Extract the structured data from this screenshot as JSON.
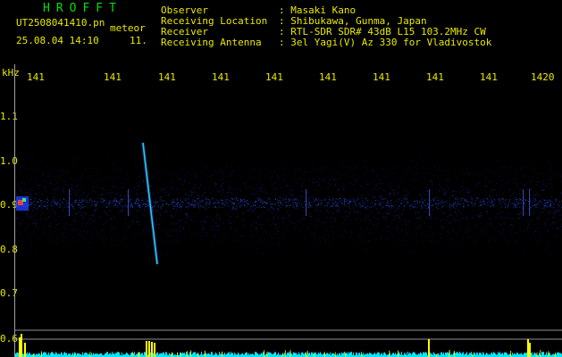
{
  "header": {
    "app_title": "HROFFT",
    "file_name": "UT2508041410.pn",
    "file_tag": "meteor",
    "datetime": "25.08.04 14:10",
    "sequence": "11."
  },
  "metadata": {
    "observer_label": "Observer",
    "observer_value": ": Masaki Kano",
    "location_label": "Receiving Location",
    "location_value": ": Shibukawa, Gunma, Japan",
    "receiver_label": "Receiver",
    "receiver_value": ": RTL-SDR SDR# 43dB L15 103.2MHz CW",
    "antenna_label": "Receiving Antenna",
    "antenna_value": ": 3el Yagi(V) Az 330 for Vladivostok"
  },
  "axis": {
    "unit_label": "kHz",
    "y_ticks": [
      "1.1",
      "1.0",
      "0.9",
      "0.8",
      "0.7",
      "0.6"
    ],
    "x_ticks": [
      "141",
      "141",
      "141",
      "141",
      "141",
      "141",
      "141",
      "141",
      "141",
      "1420"
    ]
  },
  "colors": {
    "text": "#e8e800",
    "title": "#00e000",
    "noise": "#1a2aa0",
    "spectrum": "#00e8ff",
    "spectrum_peak": "#ffff00",
    "meteor": "#40ffff"
  }
}
